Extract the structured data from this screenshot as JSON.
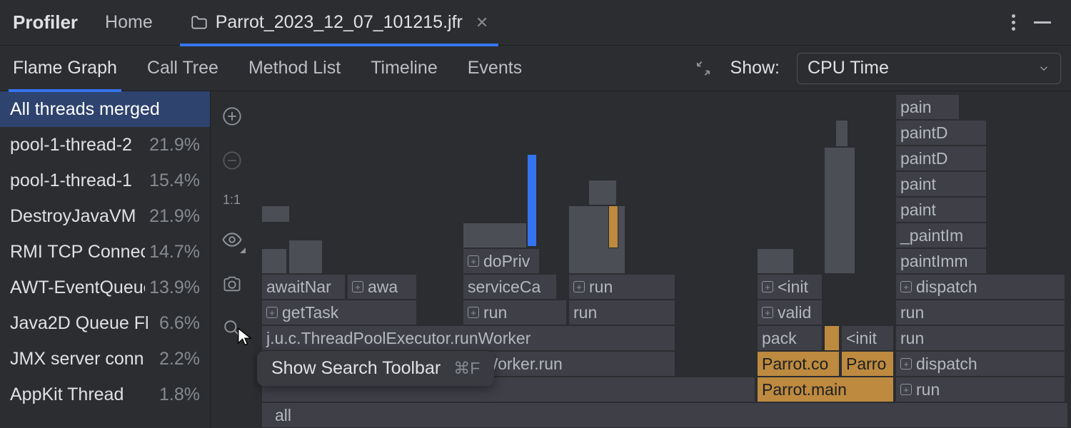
{
  "app": {
    "title": "Profiler",
    "home": "Home",
    "file": "Parrot_2023_12_07_101215.jfr"
  },
  "views": [
    "Flame Graph",
    "Call Tree",
    "Method List",
    "Timeline",
    "Events"
  ],
  "active_view": 0,
  "show": {
    "label": "Show:",
    "value": "CPU Time"
  },
  "threads": [
    {
      "name": "All threads merged",
      "pct": "",
      "selected": true
    },
    {
      "name": "pool-1-thread-2",
      "pct": "21.9%"
    },
    {
      "name": "pool-1-thread-1",
      "pct": "15.4%"
    },
    {
      "name": "DestroyJavaVM",
      "pct": "21.9%"
    },
    {
      "name": "RMI TCP Connec",
      "pct": "14.7%"
    },
    {
      "name": "AWT-EventQueue",
      "pct": "13.9%"
    },
    {
      "name": "Java2D Queue Fl",
      "pct": "6.6%"
    },
    {
      "name": "JMX server conn",
      "pct": "2.2%"
    },
    {
      "name": "AppKit Thread",
      "pct": "1.8%"
    }
  ],
  "toolbar": {
    "zoom_in": "zoom-in",
    "zoom_out": "zoom-out",
    "scale": "1:1",
    "focus": "focus",
    "capture": "capture",
    "search": "search"
  },
  "tooltip": {
    "text": "Show Search Toolbar",
    "shortcut": "⌘F"
  },
  "frames": {
    "all": "all",
    "runWorker": "j.u.c.ThreadPoolExecutor.runWorker",
    "workerRun": "$Worker.run",
    "getTask": "getTask",
    "awaitNar": "awaitNar",
    "awa": "awa",
    "run1": "run",
    "run2": "run",
    "run3": "run",
    "serviceCa": "serviceCa",
    "doPriv": "doPriv",
    "parrotMain": "Parrot.main",
    "parrotCo": "Parrot.co",
    "parrot2": "Parro",
    "pack": "pack",
    "valid": "valid",
    "init": "<init",
    "init2": "<init",
    "paint": "paint",
    "paint2": "paint",
    "paintD": "paintD",
    "paintD2": "paintD",
    "paintIm": "_paintIm",
    "paintImm": "paintImm",
    "pain": "pain",
    "run_r1": "run",
    "run_r2": "run",
    "run_r3": "run",
    "dispatch1": "dispatch",
    "dispatch2": "dispatch"
  }
}
